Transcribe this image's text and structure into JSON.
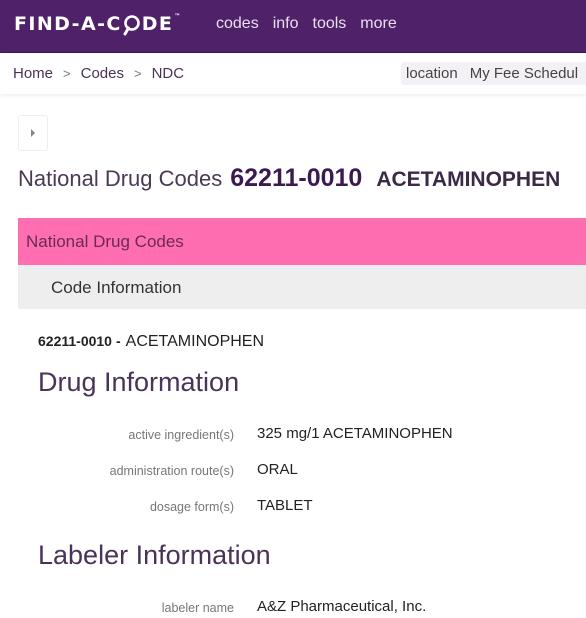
{
  "header": {
    "logo_text_left": "FIND-A-C",
    "logo_text_right": "DE",
    "logo_tm": "™",
    "nav": [
      {
        "label": "codes"
      },
      {
        "label": "info"
      },
      {
        "label": "tools"
      },
      {
        "label": "more"
      }
    ],
    "colors": {
      "bar": "#4f2168",
      "accent_pink": "#ff6eb0"
    }
  },
  "breadcrumb": {
    "items": [
      {
        "label": "Home"
      },
      {
        "label": "Codes"
      },
      {
        "label": "NDC"
      }
    ],
    "separator": ">"
  },
  "utility": {
    "location_label": "location",
    "fee_schedule_label": "My Fee Schedul"
  },
  "page": {
    "title_prefix": "National Drug Codes",
    "code": "62211-0010",
    "drug_name": "ACETAMINOPHEN"
  },
  "category_bar": {
    "label": "National Drug Codes"
  },
  "subcategory_bar": {
    "label": "Code Information"
  },
  "code_line": {
    "code": "62211-0010",
    "dash": "-",
    "description": "ACETAMINOPHEN"
  },
  "drug_info": {
    "heading": "Drug Information",
    "rows": [
      {
        "label": "active ingredient(s)",
        "value": "325 mg/1 ACETAMINOPHEN"
      },
      {
        "label": "administration route(s)",
        "value": "ORAL"
      },
      {
        "label": "dosage form(s)",
        "value": "TABLET"
      }
    ]
  },
  "labeler_info": {
    "heading": "Labeler Information",
    "rows": [
      {
        "label": "labeler name",
        "value": "A&Z Pharmaceutical, Inc."
      }
    ]
  }
}
